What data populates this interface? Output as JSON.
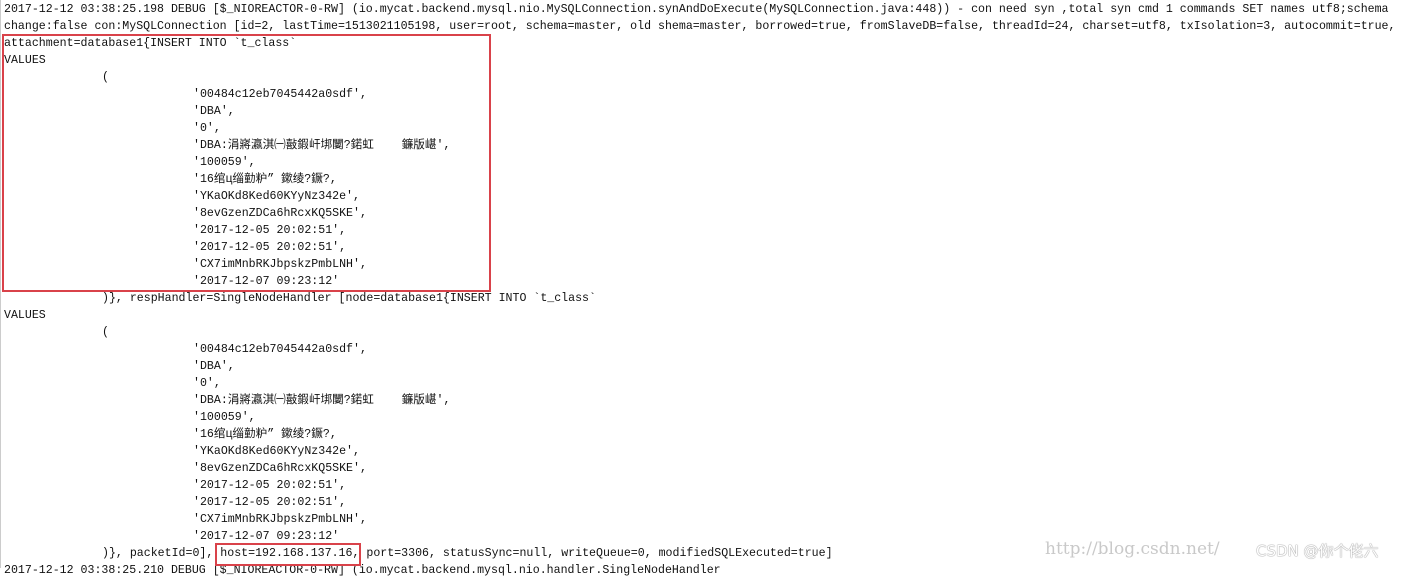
{
  "log_lines": [
    "2017-12-12 03:38:25.198 DEBUG [$_NIOREACTOR-0-RW] (io.mycat.backend.mysql.nio.MySQLConnection.synAndDoExecute(MySQLConnection.java:448)) - con need syn ,total syn cmd 1 commands SET names utf8;schema",
    "change:false con:MySQLConnection [id=2, lastTime=1513021105198, user=root, schema=master, old shema=master, borrowed=true, fromSlaveDB=false, threadId=24, charset=utf8, txIsolation=3, autocommit=true,",
    "attachment=database1{INSERT INTO `t_class`",
    "VALUES",
    "(",
    "'00484c12eb7045442a0sdf',",
    "'DBA',",
    "'0',",
    "'DBA:涓嶈瀛淇㈠敼鍜屽垹闄?鍩虹    鐮版嵁',",
    "'100059',",
    "'16绾ц缁勭粐” 鏉绫?鐝?,",
    "'YKaOKd8Ked60KYyNz342e',",
    "'8evGzenZDCa6hRcxKQ5SKE',",
    "'2017-12-05 20:02:51',",
    "'2017-12-05 20:02:51',",
    "'CX7imMnbRKJbpskzPmbLNH',",
    "'2017-12-07 09:23:12'",
    ")}, respHandler=SingleNodeHandler [node=database1{INSERT INTO `t_class`",
    "VALUES",
    "(",
    "'00484c12eb7045442a0sdf',",
    "'DBA',",
    "'0',",
    "'DBA:涓嶈瀛淇㈠敼鍜屽垹闄?鍩虹    鐮版嵁',",
    "'100059',",
    "'16绾ц缁勭粐” 鏉绫?鐝?,",
    "'YKaOKd8Ked60KYyNz342e',",
    "'8evGzenZDCa6hRcxKQ5SKE',",
    "'2017-12-05 20:02:51',",
    "'2017-12-05 20:02:51',",
    "'CX7imMnbRKJbpskzPmbLNH',",
    "'2017-12-07 09:23:12'",
    ")}, packetId=0], ",
    "2017-12-12 03:38:25.210 DEBUG [$_NIOREACTOR-0-RW] (io.mycat.backend.mysql.nio.handler.SingleNodeHandler"
  ],
  "last_line_rest": {
    "host": "host=192.168.137.16,",
    "rest": " port=3306, statusSync=null, writeQueue=0, modifiedSQLExecuted=true]"
  },
  "watermark": {
    "url": "http://blog.csdn.net/",
    "csdn": "CSDN @你个佬六"
  },
  "highlight_color": "#d9424a"
}
